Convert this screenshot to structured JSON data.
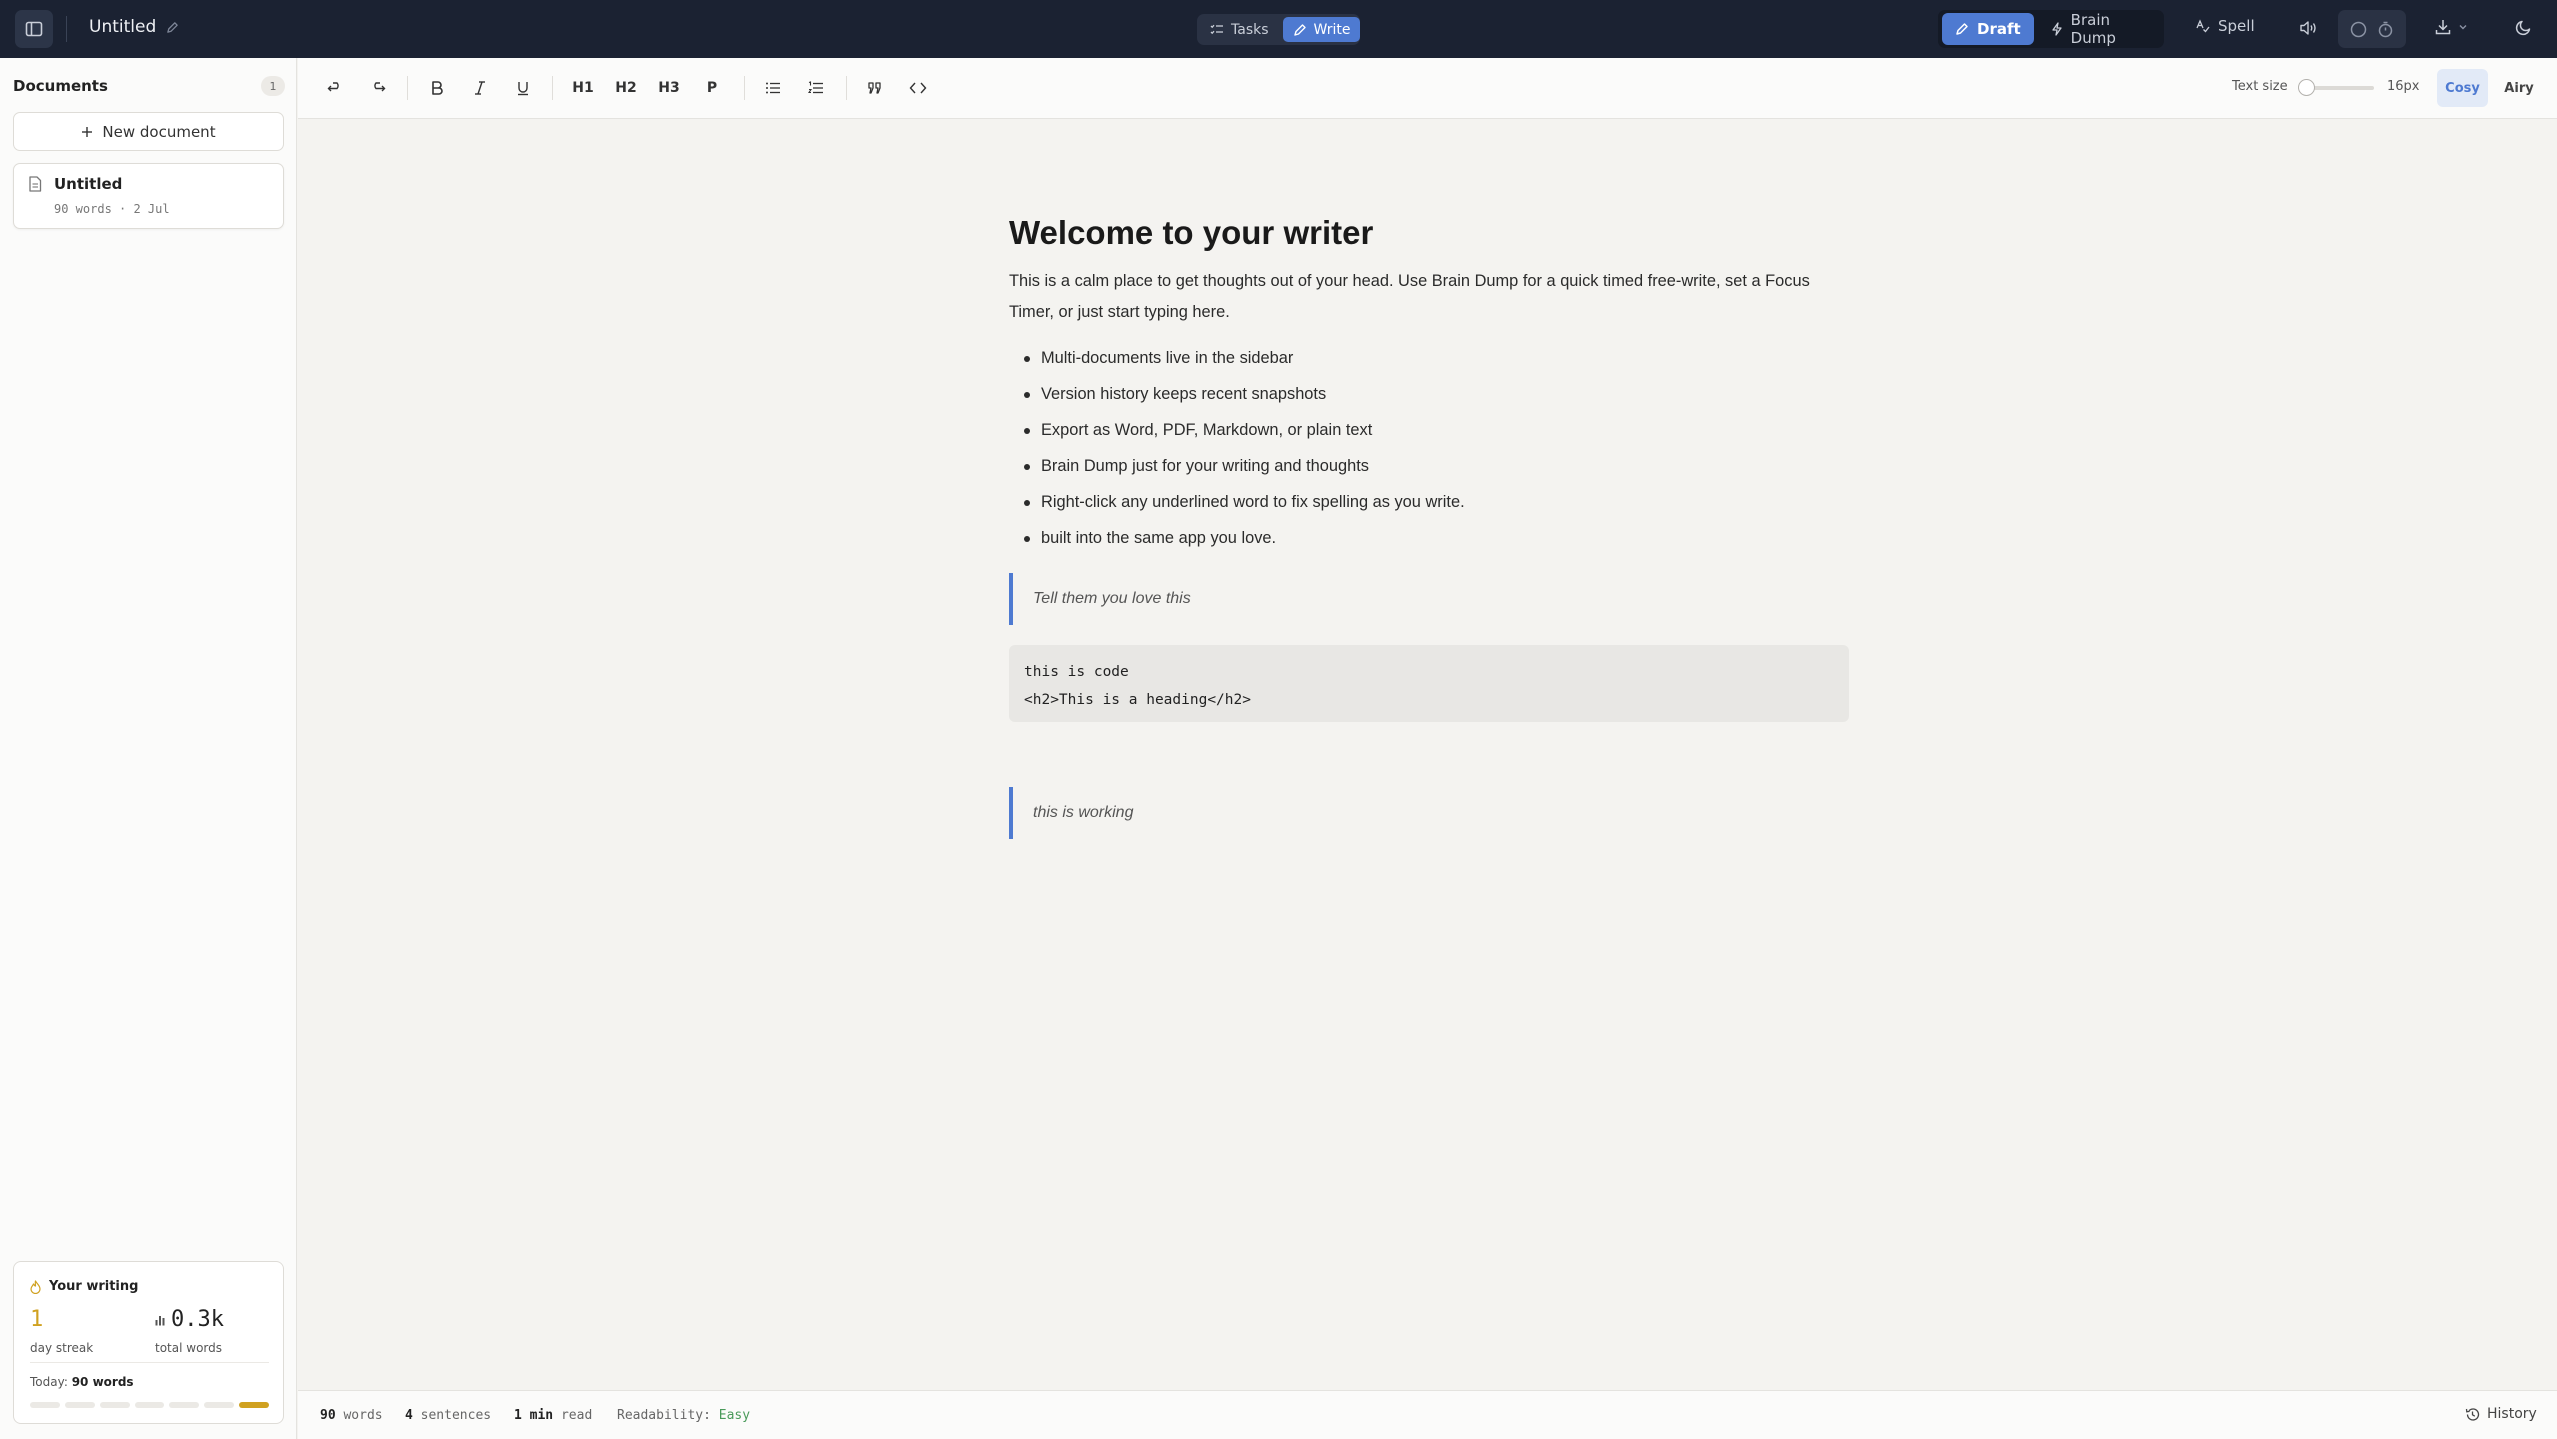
{
  "header": {
    "doc_title": "Untitled",
    "modes": [
      {
        "label": "Tasks",
        "icon": "tasks-icon",
        "active": false
      },
      {
        "label": "Write",
        "icon": "pen-icon",
        "active": true
      }
    ],
    "draft_label": "Draft",
    "brain_dump_label": "Brain Dump",
    "spell_label": "Spell",
    "accent": "#4e7ad1"
  },
  "sidebar": {
    "heading": "Documents",
    "count": "1",
    "new_doc_label": "New document",
    "documents": [
      {
        "title": "Untitled",
        "meta": "90 words · 2 Jul"
      }
    ],
    "stats": {
      "title": "Your writing",
      "streak_value": "1",
      "streak_label": "day streak",
      "total_value": "0.3k",
      "total_label": "total words",
      "today_label": "Today:",
      "today_value": "90 words",
      "week_levels": [
        0,
        0,
        0,
        0,
        0,
        0,
        1
      ]
    }
  },
  "toolbar": {
    "h1": "H1",
    "h2": "H2",
    "h3": "H3",
    "p": "P",
    "text_size_label": "Text size",
    "text_size_value": "16px",
    "cosy_label": "Cosy",
    "airy_label": "Airy"
  },
  "document": {
    "heading": "Welcome to your writer",
    "intro": "This is a calm place to get thoughts out of your head. Use Brain Dump for a quick timed free-write, set a Focus Timer, or just start typing here.",
    "bullets": [
      "Multi-documents live in the sidebar",
      "Version history keeps recent snapshots",
      "Export as Word, PDF, Markdown, or plain text",
      "Brain Dump just for your writing and thoughts",
      "Right-click any underlined word to fix spelling as you write.",
      "built into the same app you love."
    ],
    "quote_1": "Tell them you love this",
    "code": "this is code\n<h2>This is a heading</h2>",
    "quote_2": "this is working"
  },
  "status": {
    "words_value": "90",
    "words_label": "words",
    "sentences_value": "4",
    "sentences_label": "sentences",
    "read_value": "1 min",
    "read_label": "read",
    "readability_label": "Readability:",
    "readability_value": "Easy",
    "history_label": "History"
  }
}
